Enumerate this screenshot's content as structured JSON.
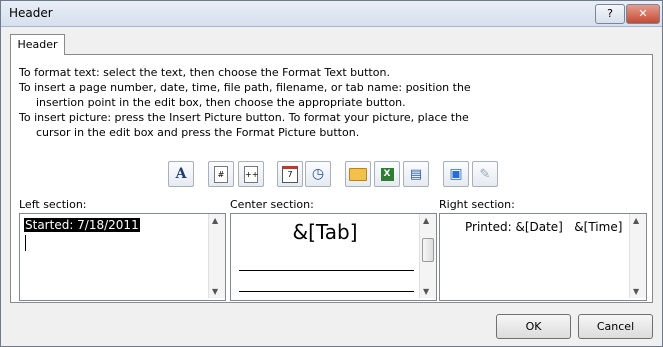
{
  "window": {
    "title": "Header",
    "help_label": "?",
    "close_label": "✕"
  },
  "tab": {
    "label": "Header"
  },
  "instructions": {
    "line1": "To format text:  select the text, then choose the Format Text button.",
    "line2": "To insert a page number, date, time, file path, filename, or tab name:  position the",
    "line3": "insertion point in the edit box, then choose the appropriate button.",
    "line4": "To insert picture: press the Insert Picture button.  To format your picture, place the",
    "line5": "cursor in the edit box and press the Format Picture button."
  },
  "toolbar": {
    "format_text": "A",
    "page_number": "#",
    "num_pages": "++",
    "date": "7",
    "time": "◷",
    "file_path": "📂",
    "filename": "X",
    "sheet_name": "▤",
    "insert_picture": "▣",
    "format_picture": "✎"
  },
  "sections": {
    "left": {
      "label": "Left section:",
      "text": "Started: 7/18/2011"
    },
    "center": {
      "label": "Center section:",
      "text": "&[Tab]"
    },
    "right": {
      "label": "Right section:",
      "text": "Printed: &[Date]   &[Time]"
    }
  },
  "buttons": {
    "ok": "OK",
    "cancel": "Cancel"
  }
}
